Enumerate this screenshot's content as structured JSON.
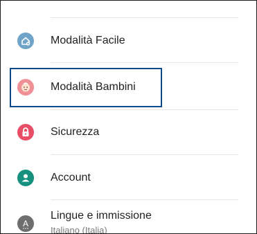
{
  "settings": {
    "items": [
      {
        "label": "Modalità Facile",
        "icon": "easy-mode-icon",
        "color": "#6fa4c8"
      },
      {
        "label": "Modalità Bambini",
        "icon": "kids-mode-icon",
        "color": "#ef8f96"
      },
      {
        "label": "Sicurezza",
        "icon": "lock-icon",
        "color": "#e94e67"
      },
      {
        "label": "Account",
        "icon": "account-icon",
        "color": "#16907f"
      },
      {
        "label": "Lingue e immissione",
        "sublabel": "Italiano (Italia)",
        "icon": "language-icon",
        "color": "#6e6e6e"
      }
    ],
    "selected_index": 1
  }
}
